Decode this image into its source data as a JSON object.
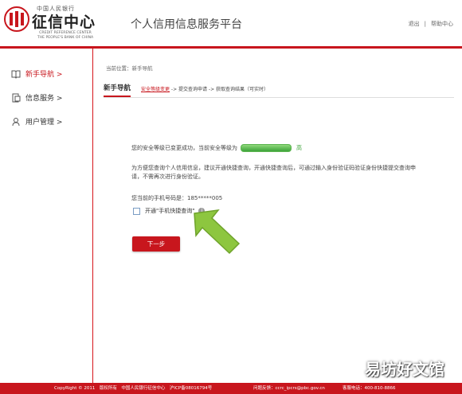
{
  "header": {
    "logo_small": "中国人民银行",
    "logo_main": "征信中心",
    "logo_en_line1": "CREDIT REFERENCE CENTER",
    "logo_en_line2": "THE PEOPLE'S BANK OF CHINA",
    "platform_title": "个人信用信息服务平台",
    "logout": "退出",
    "separator": "|",
    "help": "帮助中心"
  },
  "sidebar": {
    "items": [
      {
        "label": "新手导航 >",
        "icon": "book-icon",
        "active": true
      },
      {
        "label": "信息服务 >",
        "icon": "document-icon",
        "active": false
      },
      {
        "label": "用户管理 >",
        "icon": "user-icon",
        "active": false
      }
    ]
  },
  "breadcrumb": "当前位置：新手导航",
  "guide": {
    "title": "新手导航",
    "step1": "安全等级变更",
    "step2": " -> 提交查询申请 -> 获取查询结果（可实时）"
  },
  "main": {
    "security_msg": "您的安全等级已变更成功，当前安全等级为",
    "level": "高",
    "para": "为方便您查询个人信用信息，建议开通快捷查询，开通快捷查询后，可通过输入身份验证码验证身份快捷提交查询申请，不需再次进行身份验证。",
    "phone": "您当前的手机号码是：185*****005",
    "optin_label": "开通\"手机快捷查询\"",
    "info_glyph": "i",
    "next_button": "下一步"
  },
  "footer": {
    "copyright": "CopyRight © 2011　版权所有　中国人民银行征信中心　沪ICP备08016794号",
    "feedback": "问题反馈：ccrc_ipcrs@pbc.gov.cn",
    "hotline": "客服电话：400-810-8866"
  },
  "watermark": "易坊好文馆",
  "colors": {
    "accent": "#c8161d",
    "level_green": "#3da33a",
    "arrow_green": "#8dc63f"
  }
}
